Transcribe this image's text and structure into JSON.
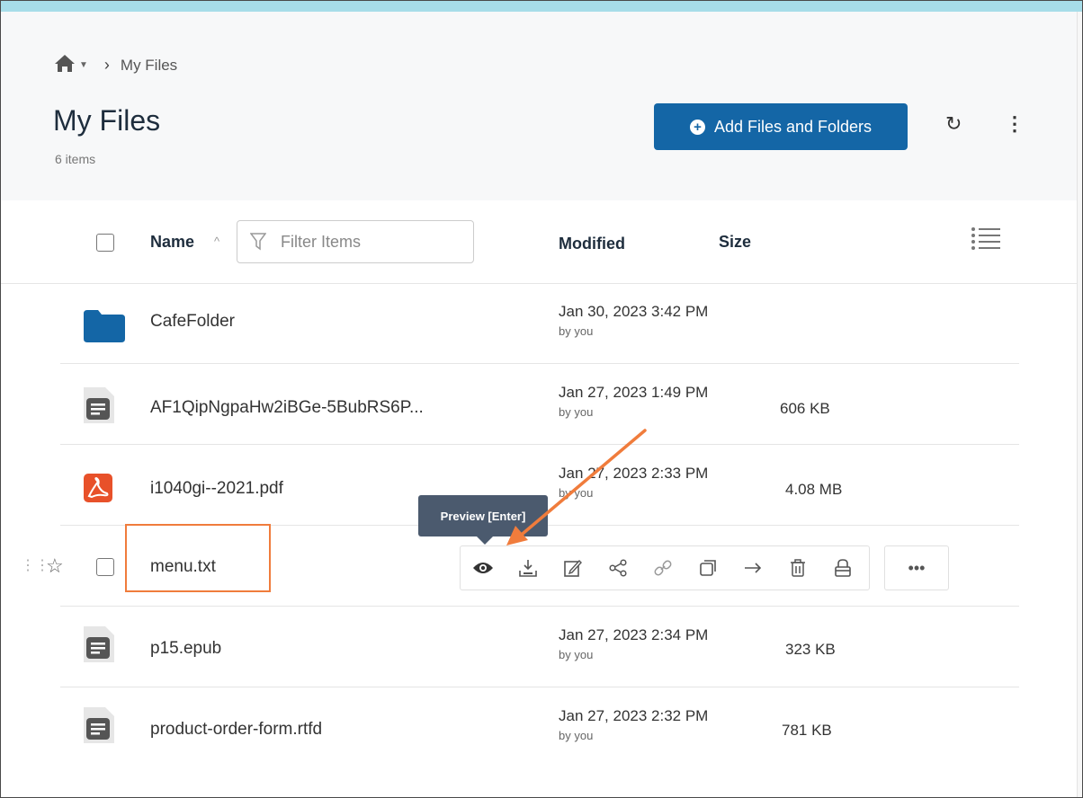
{
  "breadcrumb": {
    "current": "My Files"
  },
  "header": {
    "title": "My Files",
    "item_count": "6 items",
    "add_button": "Add Files and Folders"
  },
  "columns": {
    "name": "Name",
    "filter_placeholder": "Filter Items",
    "modified": "Modified",
    "size": "Size"
  },
  "files": [
    {
      "name": "CafeFolder",
      "type": "folder",
      "modified": "Jan 30, 2023 3:42 PM",
      "by": "by you",
      "size": ""
    },
    {
      "name": "AF1QipNgpaHw2iBGe-5BubRS6P...",
      "type": "document",
      "modified": "Jan 27, 2023 1:49 PM",
      "by": "by you",
      "size": "606 KB"
    },
    {
      "name": "i1040gi--2021.pdf",
      "type": "pdf",
      "modified": "Jan 27, 2023 2:33 PM",
      "by": "by you",
      "size": "4.08 MB"
    },
    {
      "name": "menu.txt",
      "type": "text",
      "modified": "",
      "by": "",
      "size": ""
    },
    {
      "name": "p15.epub",
      "type": "document",
      "modified": "Jan 27, 2023 2:34 PM",
      "by": "by you",
      "size": "323 KB"
    },
    {
      "name": "product-order-form.rtfd",
      "type": "document",
      "modified": "Jan 27, 2023 2:32 PM",
      "by": "by you",
      "size": "781 KB"
    }
  ],
  "tooltip": {
    "text": "Preview [Enter]"
  },
  "row_actions": [
    "preview-icon",
    "download-icon",
    "edit-icon",
    "share-icon",
    "link-icon",
    "copy-icon",
    "move-icon",
    "delete-icon",
    "lock-icon",
    "more-icon"
  ],
  "colors": {
    "accent": "#1466a6",
    "highlight": "#f07c3c",
    "top_bar": "#a7dde9",
    "tooltip_bg": "#4b5a6e",
    "pdf_red": "#e8512a"
  }
}
